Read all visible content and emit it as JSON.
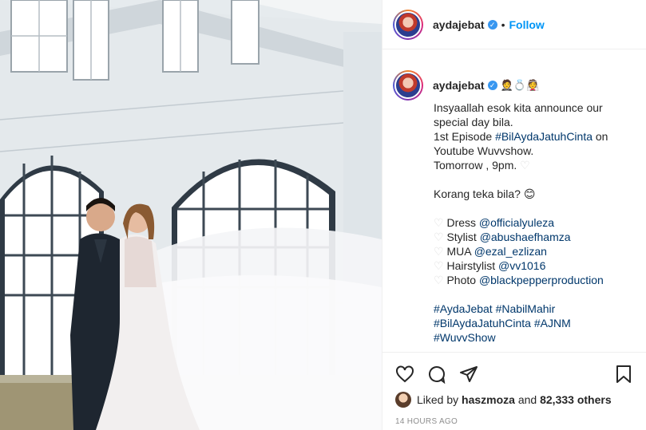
{
  "post": {
    "username": "aydajebat",
    "follow_label": "Follow",
    "separator": "•",
    "caption_emojis": "🤵💍👰",
    "caption_lines": [
      "Insyaallah esok kita announce our",
      "special day bila."
    ],
    "episode_prefix": "1st Episode ",
    "episode_tag": "#BilAydaJatuhCinta",
    "episode_suffix": " on",
    "episode_line2": "Youtube Wuvvshow.",
    "tomorrow": "Tomorrow , 9pm.",
    "guess": "Korang teka bila?",
    "guess_emoji": "😊",
    "credits": [
      {
        "label": "Dress",
        "handle": "@officialyuleza"
      },
      {
        "label": "Stylist",
        "handle": "@abushaefhamza"
      },
      {
        "label": "MUA",
        "handle": "@ezal_ezlizan"
      },
      {
        "label": "Hairstylist",
        "handle": "@vv1016"
      },
      {
        "label": "Photo",
        "handle": "@blackpepperproduction"
      }
    ],
    "hashtags": {
      "line1a": "#AydaJebat",
      "line1b": "#NabilMahir",
      "line2a": "#BilAydaJatuhCinta",
      "line2b": "#AJNM",
      "line3": "#WuvvShow"
    },
    "likes_prefix": "Liked by",
    "liked_by": "haszmoza",
    "likes_join": "and",
    "likes_count": "82,333 others",
    "timestamp": "14 HOURS AGO"
  },
  "icons": [
    "heart-icon",
    "comment-icon",
    "share-icon",
    "bookmark-icon",
    "verified-badge-icon"
  ],
  "colors": {
    "link": "#00376b",
    "follow": "#0095f6",
    "verified": "#3897f0",
    "muted": "#8e8e8e"
  }
}
